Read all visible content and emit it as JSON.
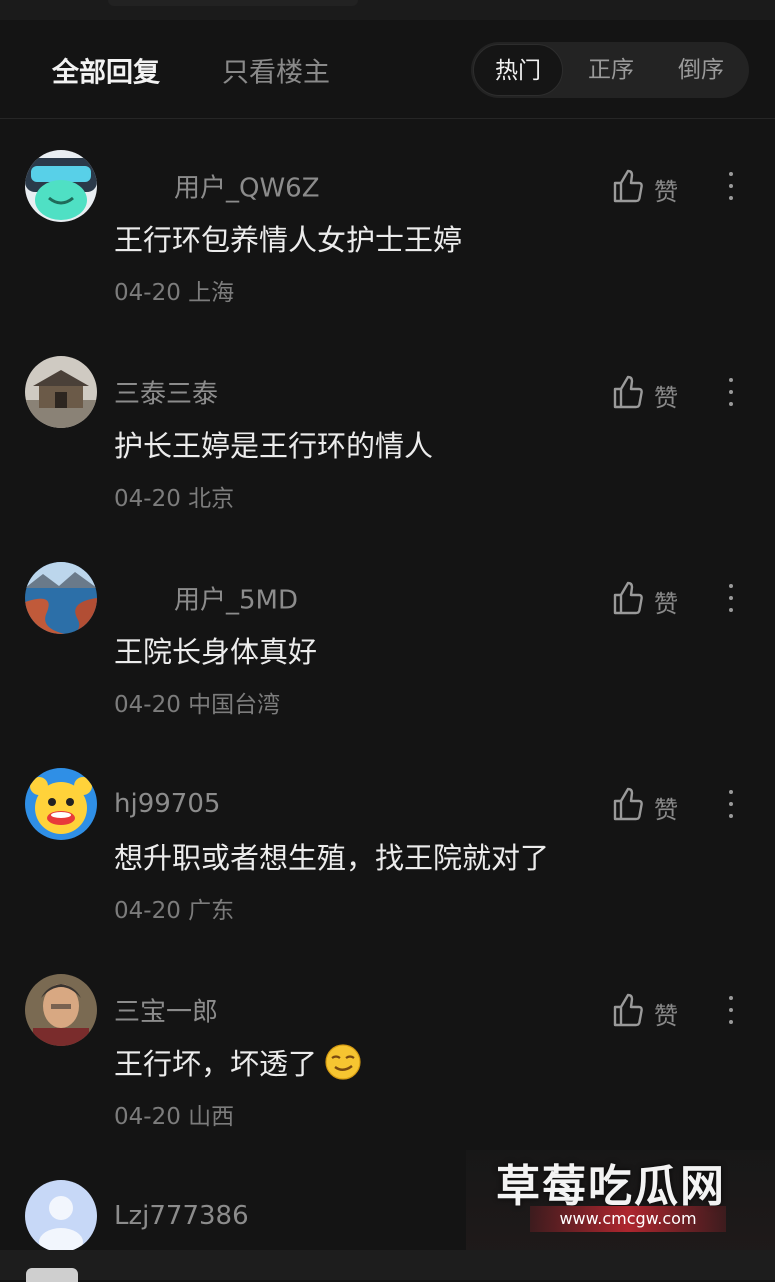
{
  "tabs": {
    "all_replies": "全部回复",
    "op_only": "只看楼主"
  },
  "sort": {
    "hot": "热门",
    "ascending": "正序",
    "descending": "倒序",
    "selected": "热门"
  },
  "like_label": "赞",
  "comments": [
    {
      "username": "用户_QW6Z",
      "text": "王行环包养情人女护士王婷",
      "date": "04-20",
      "location": "上海",
      "avatar": "robot-mask-avatar"
    },
    {
      "username": "三泰三泰",
      "text": "护长王婷是王行环的情人",
      "date": "04-20",
      "location": "北京",
      "avatar": "gate-photo-avatar"
    },
    {
      "username": "用户_5MD",
      "text": "王院长身体真好",
      "date": "04-20",
      "location": "中国台湾",
      "avatar": "landscape-photo-avatar"
    },
    {
      "username": "hj99705",
      "text": "想升职或者想生殖，找王院就对了",
      "date": "04-20",
      "location": "广东",
      "avatar": "clown-avatar"
    },
    {
      "username": "三宝一郎",
      "text": "王行坏，坏透了",
      "emoji": "smirk-emoji",
      "date": "04-20",
      "location": "山西",
      "avatar": "man-photo-avatar"
    },
    {
      "username": "Lzj777386",
      "avatar": "default-avatar"
    }
  ],
  "watermark": {
    "title": "草莓吃瓜网",
    "url": "www.cmcgw.com"
  },
  "colors": {
    "background": "#141414",
    "text_primary": "#ececec",
    "text_secondary": "#8c8c8c"
  }
}
